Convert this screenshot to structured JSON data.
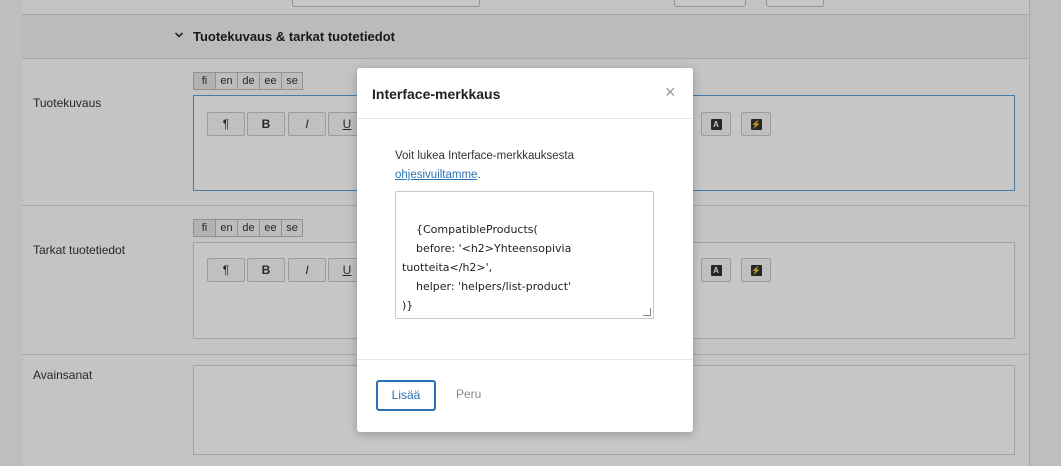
{
  "section": {
    "title": "Tuotekuvaus & tarkat tuotetiedot",
    "chevron_icon": "chevron-down-icon"
  },
  "languages": [
    "fi",
    "en",
    "de",
    "ee",
    "se"
  ],
  "fields": {
    "description": {
      "label": "Tuotekuvaus"
    },
    "details": {
      "label": "Tarkat tuotetiedot"
    },
    "keywords": {
      "label": "Avainsanat"
    }
  },
  "toolbar": {
    "paragraph": "¶",
    "bold": "B",
    "italic": "I",
    "underline": "U"
  },
  "modal": {
    "title": "Interface-merkkaus",
    "close_symbol": "×",
    "text_before": "Voit lukea Interface-merkkauksesta",
    "link_text": "ohjesivuiltamme",
    "text_after": ".",
    "code": "{CompatibleProducts(\n    before: '<h2>Yhteensopivia\ntuotteita</h2>',\n    helper: 'helpers/list-product'\n)}",
    "add_label": "Lisää",
    "cancel_label": "Peru"
  },
  "colors": {
    "accent": "#2a72b5",
    "focus_border": "#5a9fd6"
  }
}
